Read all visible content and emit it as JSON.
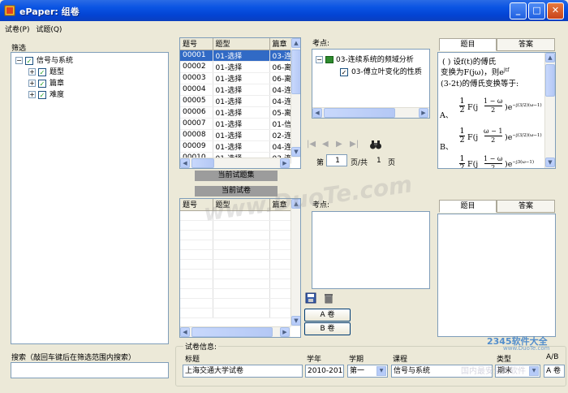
{
  "window": {
    "title": "ePaper: 组卷"
  },
  "menu": [
    "试卷(P)",
    "试题(Q)"
  ],
  "filter": {
    "label": "筛选",
    "tree": {
      "root": "信号与系统",
      "children": [
        "题型",
        "篇章",
        "难度"
      ]
    },
    "search_label": "搜索（敲回车键后在筛选范围内搜索）",
    "search_value": ""
  },
  "question_bank": {
    "columns": [
      "题号",
      "题型",
      "篇章"
    ],
    "rows": [
      [
        "00001",
        "01-选择",
        "03-连"
      ],
      [
        "00002",
        "01-选择",
        "06-离"
      ],
      [
        "00003",
        "01-选择",
        "06-离"
      ],
      [
        "00004",
        "01-选择",
        "04-连"
      ],
      [
        "00005",
        "01-选择",
        "04-连"
      ],
      [
        "00006",
        "01-选择",
        "05-离"
      ],
      [
        "00007",
        "01-选择",
        "01-信"
      ],
      [
        "00008",
        "01-选择",
        "02-连"
      ],
      [
        "00009",
        "01-选择",
        "04-连"
      ],
      [
        "00010",
        "01-选择",
        "03-连"
      ]
    ],
    "current_set_label": "当前试题集"
  },
  "current_paper": {
    "label": "当前试卷",
    "columns": [
      "题号",
      "题型",
      "篇章"
    ]
  },
  "kaodian": {
    "label": "考点:",
    "tree": [
      "03-连续系统的频域分析",
      "03-傅立叶变化的性质"
    ]
  },
  "kaodian2": {
    "label": "考点:"
  },
  "pager": {
    "page_prefix": "第",
    "page_value": "1",
    "page_mid": "页/共",
    "total": "1",
    "page_suffix": "页"
  },
  "preview": {
    "tab_question": "题目",
    "tab_answer": "答案",
    "text_line1": "(     )    设f(t)的傅氏",
    "text_line2": "变换为F(jω)，则e",
    "text_line2_sup": "jtf",
    "text_line3": "(3-2t)的傅氏变换等于:",
    "option_a": "A、",
    "option_b": "B、",
    "frac_half": "1",
    "frac_den": "2",
    "expr_a": "F(j",
    "expr_a_num": "1 − ω",
    "expr_a_den": "2",
    "expr_a_tail": ")e",
    "expr_a_sup": "−j(3/2)(ω−1)",
    "expr_b_num": "ω − 1",
    "expr_b_den": "2",
    "expr_b_sup": "−j(3/2)(ω−1)",
    "expr_c_num": "1 − ω",
    "expr_c_den": "2",
    "expr_c_sup": "−j3(ω−1)"
  },
  "preview2": {
    "tab_question": "题目",
    "tab_answer": "答案"
  },
  "ab_buttons": {
    "a": "A 卷",
    "b": "B 卷"
  },
  "paper_info": {
    "label": "试卷信息:",
    "title_label": "标题",
    "title_value": "上海交通大学试卷",
    "year_label": "学年",
    "year_value": "2010-201",
    "term_label": "学期",
    "term_value": "第一",
    "course_label": "课程",
    "course_value": "信号与系统",
    "type_label": "类型",
    "type_value": "期末",
    "ab_label": "A/B",
    "ab_value": "A 卷"
  },
  "watermarks": {
    "main": "www.DuoTe.com",
    "brand": "2345软件大全",
    "brand_url": "www.DuoTe.com",
    "brand_tag": "国内最安全的软件"
  }
}
